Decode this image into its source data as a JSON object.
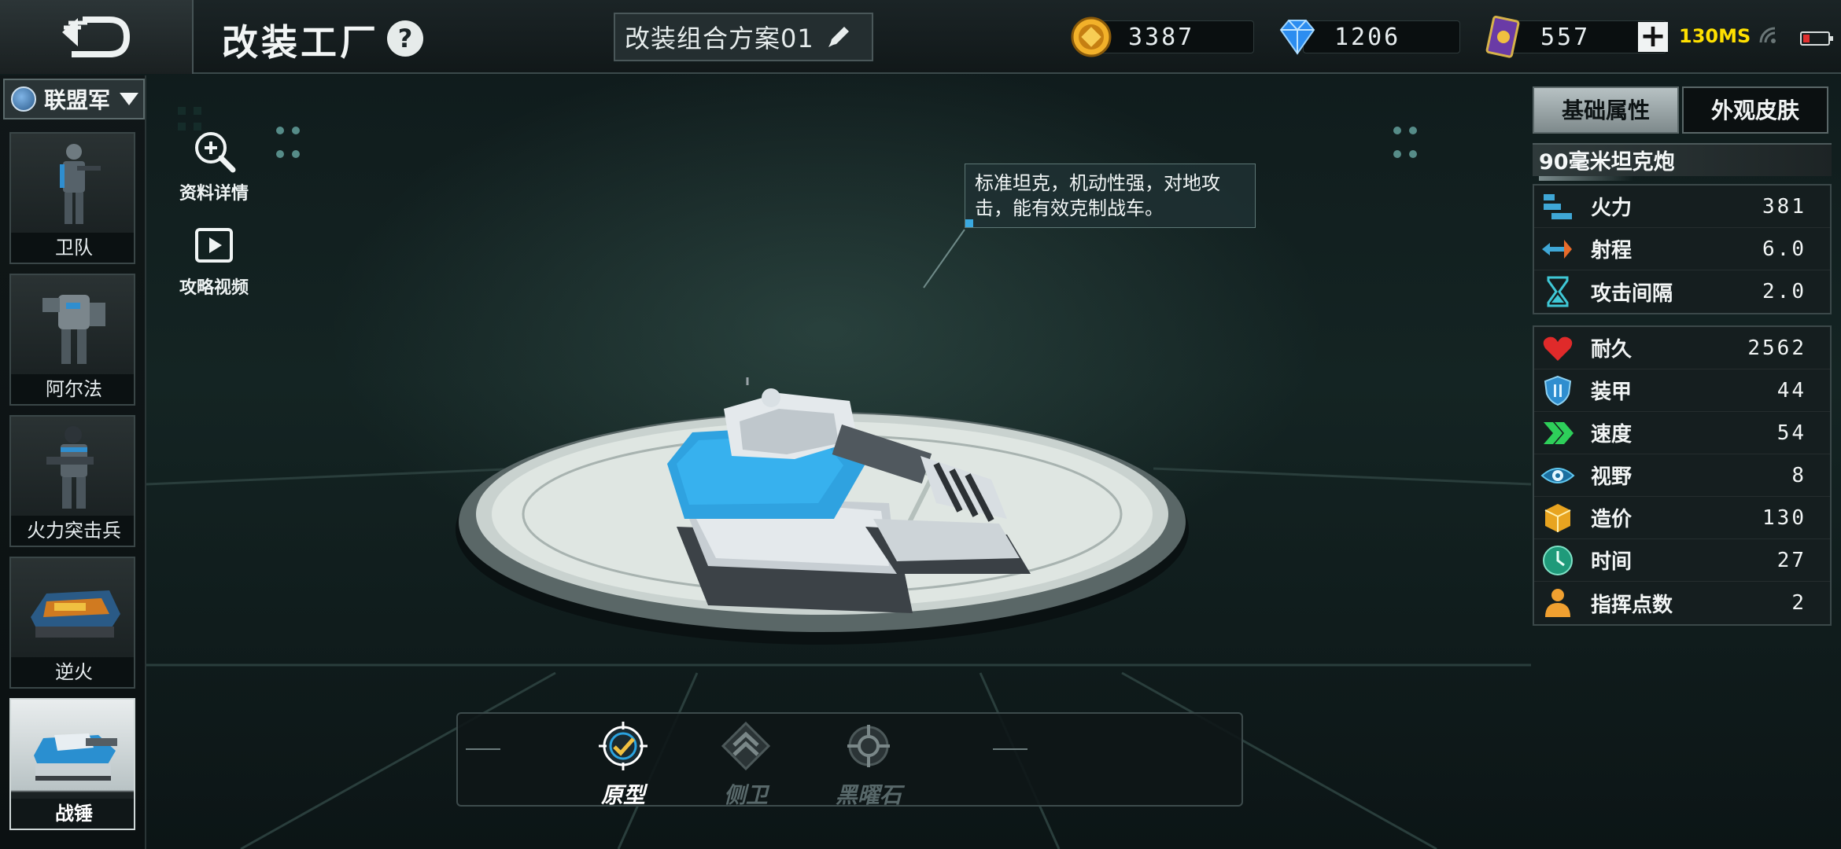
{
  "header": {
    "title": "改装工厂",
    "help": "?",
    "loadout_name": "改装组合方案01",
    "currencies": [
      {
        "name": "gold-coin",
        "value": "3387"
      },
      {
        "name": "diamond",
        "value": "1206"
      },
      {
        "name": "card",
        "value": "557"
      }
    ],
    "add_label": "+",
    "ping": "130MS"
  },
  "sidebar": {
    "faction": "联盟军",
    "units": [
      {
        "label": "卫队"
      },
      {
        "label": "阿尔法"
      },
      {
        "label": "火力突击兵"
      },
      {
        "label": "逆火"
      },
      {
        "label": "战锤"
      }
    ],
    "selected_index": 4
  },
  "tools": {
    "details": "资料详情",
    "video": "攻略视频"
  },
  "description": "标准坦克，机动性强，对地攻击，能有效克制战车。",
  "stats_panel": {
    "tabs": [
      "基础属性",
      "外观皮肤"
    ],
    "active_tab": 0,
    "weapon": "90毫米坦克炮",
    "weapon_stats": [
      {
        "icon": "firepower-icon",
        "label": "火力",
        "value": "381"
      },
      {
        "icon": "range-icon",
        "label": "射程",
        "value": "6.0"
      },
      {
        "icon": "hourglass-icon",
        "label": "攻击间隔",
        "value": "2.0"
      }
    ],
    "unit_stats": [
      {
        "icon": "heart-icon",
        "label": "耐久",
        "value": "2562"
      },
      {
        "icon": "shield-icon",
        "label": "装甲",
        "value": "44"
      },
      {
        "icon": "speed-icon",
        "label": "速度",
        "value": "54"
      },
      {
        "icon": "eye-icon",
        "label": "视野",
        "value": "8"
      },
      {
        "icon": "cost-cube-icon",
        "label": "造价",
        "value": "130"
      },
      {
        "icon": "clock-icon",
        "label": "时间",
        "value": "27"
      },
      {
        "icon": "command-points-icon",
        "label": "指挥点数",
        "value": "2"
      }
    ]
  },
  "variants": [
    {
      "label": "原型",
      "state": "active"
    },
    {
      "label": "侧卫",
      "state": "locked"
    },
    {
      "label": "黑曜石",
      "state": "locked"
    }
  ],
  "colors": {
    "accent_blue": "#2aa3e0",
    "ping_yellow": "#ffe000",
    "gold": "#e8a420"
  }
}
